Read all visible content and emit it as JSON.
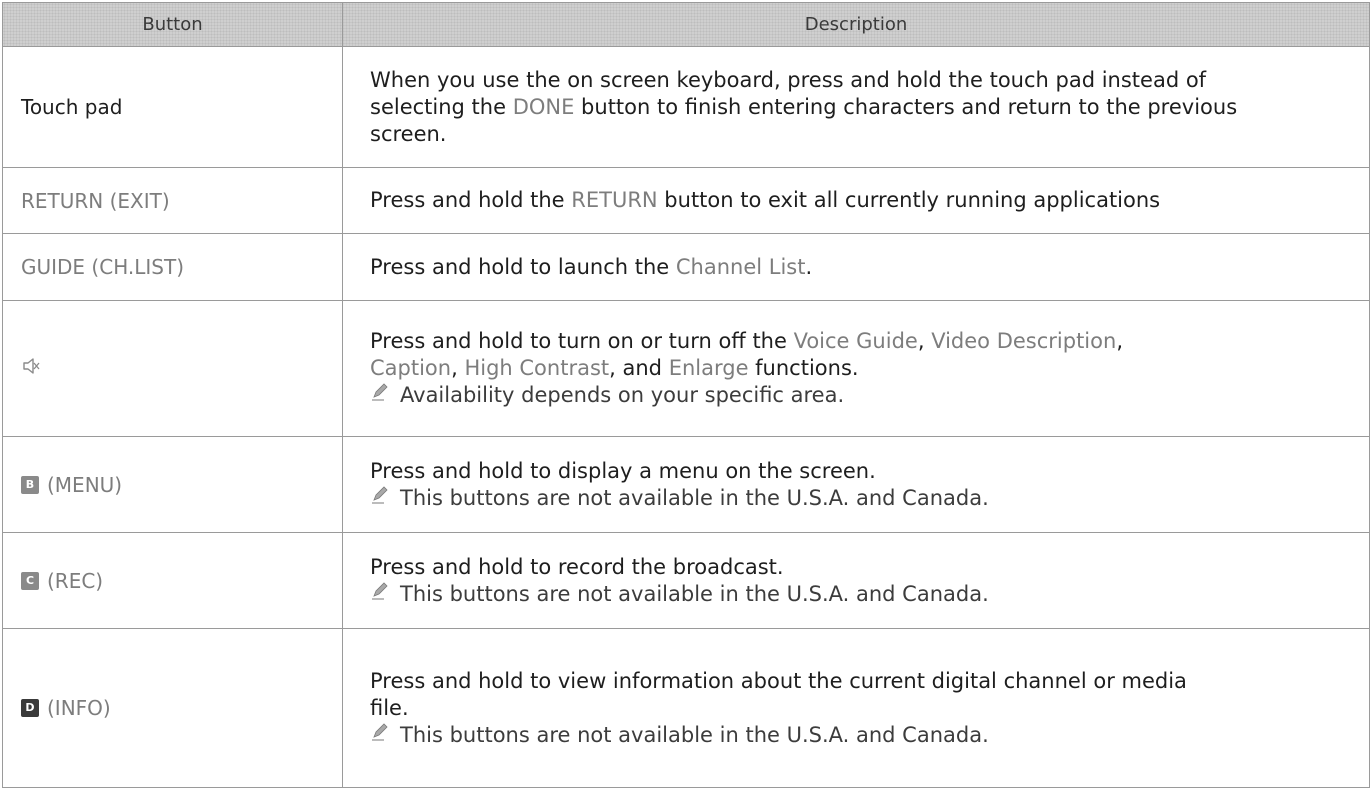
{
  "header": {
    "col_button": "Button",
    "col_description": "Description"
  },
  "rows": [
    {
      "button": "Touch pad",
      "desc_lines": [
        "When you use the on screen keyboard, press and hold the touch pad instead of",
        "selecting the ",
        "DONE",
        " button to finish entering characters and return to the previous",
        "screen."
      ]
    },
    {
      "button": "RETURN (EXIT)",
      "desc_a": "Press and hold the ",
      "desc_hl": "RETURN",
      "desc_b": " button to exit all currently running applications"
    },
    {
      "button": "GUIDE (CH.LIST)",
      "desc_a": "Press and hold to launch the ",
      "desc_hl": "Channel List",
      "desc_b": "."
    },
    {
      "button_icon": "mute-icon",
      "desc_parts": [
        "Press and hold to turn on or turn off the ",
        "Voice Guide",
        ", ",
        "Video Description",
        ",",
        "Caption",
        ", ",
        "High Contrast",
        ", and ",
        "Enlarge",
        " functions."
      ],
      "note": "Availability depends on your specific area."
    },
    {
      "button_key": "B",
      "button": "(MENU)",
      "desc": "Press and hold to display a menu on the screen.",
      "note": "This buttons are not available in the U.S.A. and Canada."
    },
    {
      "button_key": "C",
      "button": "(REC)",
      "desc": "Press and hold to record the broadcast.",
      "note": "This buttons are not available in the U.S.A. and Canada."
    },
    {
      "button_key": "D",
      "button": "(INFO)",
      "desc_line1": "Press and hold to view information about the current digital channel or media",
      "desc_line2": "file.",
      "note": "This buttons are not available in the U.S.A. and Canada."
    }
  ],
  "icons": {
    "note": "pencil-note-icon",
    "key_b_color": "#8a8a8a",
    "key_c_color": "#8a8a8a",
    "key_d_color": "#3a3a3a"
  }
}
